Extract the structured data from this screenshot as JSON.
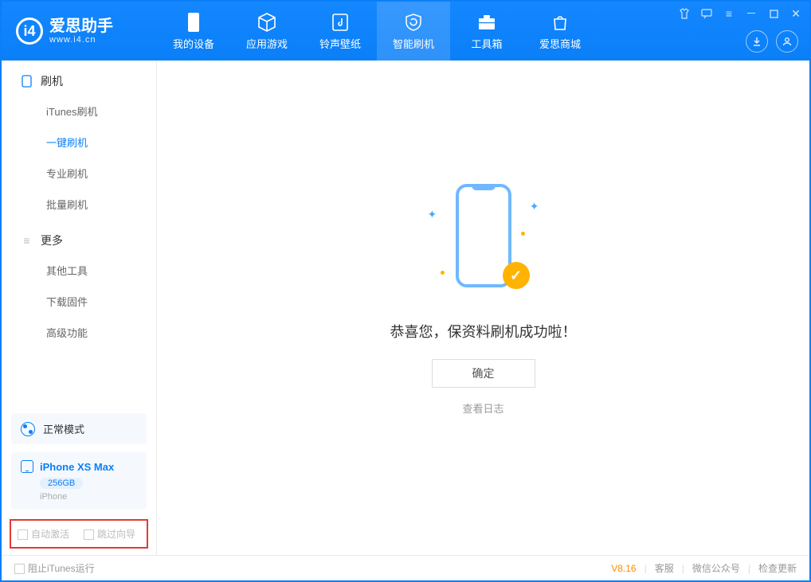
{
  "app": {
    "title": "爱思助手",
    "subtitle": "www.i4.cn"
  },
  "tabs": {
    "device": "我的设备",
    "apps": "应用游戏",
    "ring": "铃声壁纸",
    "flash": "智能刷机",
    "tools": "工具箱",
    "store": "爱思商城"
  },
  "sidebar": {
    "group_flash": "刷机",
    "items_flash": {
      "itunes": "iTunes刷机",
      "onekey": "一键刷机",
      "pro": "专业刷机",
      "batch": "批量刷机"
    },
    "group_more": "更多",
    "items_more": {
      "other": "其他工具",
      "firmware": "下载固件",
      "advanced": "高级功能"
    }
  },
  "mode": {
    "label": "正常模式"
  },
  "device": {
    "name": "iPhone XS Max",
    "storage": "256GB",
    "type": "iPhone"
  },
  "checkboxes": {
    "auto_activate": "自动激活",
    "skip_guide": "跳过向导"
  },
  "main": {
    "success": "恭喜您，保资料刷机成功啦！",
    "ok": "确定",
    "view_log": "查看日志"
  },
  "footer": {
    "block_itunes": "阻止iTunes运行",
    "version": "V8.16",
    "support": "客服",
    "wechat": "微信公众号",
    "update": "检查更新"
  }
}
